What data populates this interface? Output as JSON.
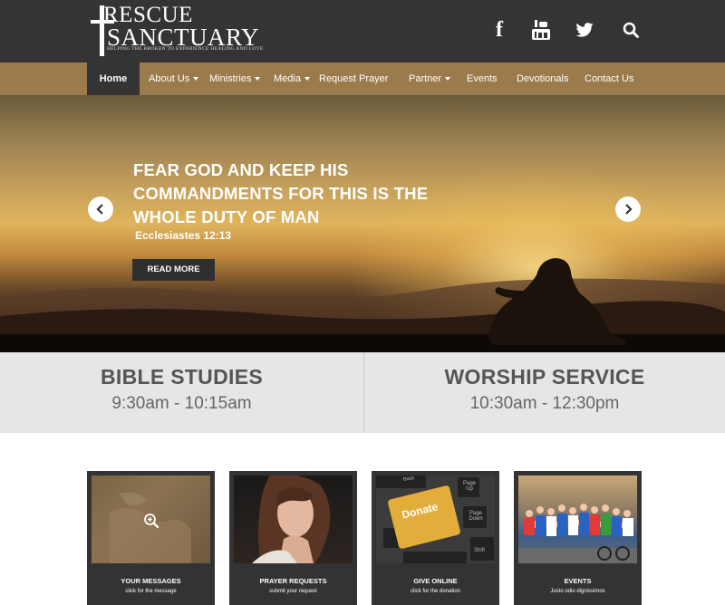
{
  "header": {
    "logo": {
      "line1": "RESCUE",
      "line2": "SANCTUARY",
      "tagline": "HELPING THE BROKEN TO EXPERIENCE HEALING AND LOVE"
    },
    "social": {
      "facebook_glyph": "f",
      "youtube_icon": "youtube-icon",
      "twitter_icon": "twitter-icon",
      "search_icon": "search-icon"
    }
  },
  "nav": {
    "items": [
      {
        "label": "Home"
      },
      {
        "label": "About Us"
      },
      {
        "label": "Ministries"
      },
      {
        "label": "Media"
      },
      {
        "label": "Request Prayer"
      },
      {
        "label": "Partner"
      },
      {
        "label": "Events"
      },
      {
        "label": "Devotionals"
      },
      {
        "label": "Contact Us"
      }
    ]
  },
  "hero": {
    "title": "FEAR GOD AND KEEP HIS COMMANDMENTS FOR THIS IS THE WHOLE DUTY OF MAN",
    "reference": "Ecclesiastes 12:13",
    "button": "READ MORE"
  },
  "schedule": {
    "left": {
      "title": "BIBLE STUDIES",
      "time": "9:30am - 10:15am"
    },
    "right": {
      "title": "WORSHIP SERVICE",
      "time": "10:30am - 12:30pm"
    }
  },
  "cards": [
    {
      "title": "YOUR MESSAGES",
      "subtitle": "click for the message"
    },
    {
      "title": "PRAYER REQUESTS",
      "subtitle": "submit your request"
    },
    {
      "title": "GIVE ONLINE",
      "subtitle": "click for the donation",
      "key_label": "Donate",
      "keys": [
        "Back",
        "Page Up",
        "Page Down",
        "Shift"
      ]
    },
    {
      "title": "EVENTS",
      "subtitle": "Justo odio dignissimos"
    }
  ],
  "colors": {
    "header_bg": "#343434",
    "nav_bg": "#9b7a4c",
    "schedule_bg": "#e6e6e6",
    "card_bg": "#333333"
  }
}
